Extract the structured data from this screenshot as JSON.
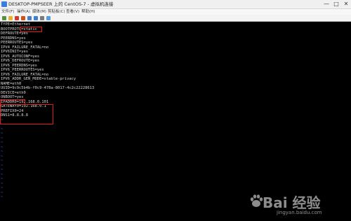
{
  "window": {
    "title": "DESKTOP-PMPSEER 上的 CentOS-7 - 虚拟机连接",
    "minimize": "—",
    "maximize": "□",
    "close": "✕"
  },
  "menu": [
    {
      "label": "文件(F)"
    },
    {
      "label": "操作(A)"
    },
    {
      "label": "媒体(M)"
    },
    {
      "label": "剪贴板(C)"
    },
    {
      "label": "查看(V)"
    },
    {
      "label": "帮助(H)"
    }
  ],
  "toolbar": {
    "colors": [
      "#5a8f3c",
      "#e6b32e",
      "#d23a2a",
      "#d24f20",
      "#4a7acb",
      "#3e7fd6",
      "#7a7a7a",
      "#5b9bd5"
    ]
  },
  "terminal": {
    "lines": [
      "TYPE=Ethernet",
      "BOOTPROTO=static",
      "DEFROUTE=yes",
      "PEERDNS=yes",
      "PEERROUTES=yes",
      "IPV4_FAILURE_FATAL=no",
      "IPV6INIT=yes",
      "IPV6_AUTOCONF=yes",
      "IPV6_DEFROUTE=yes",
      "IPV6_PEERDNS=yes",
      "IPV6_PEERROUTES=yes",
      "IPV6_FAILURE_FATAL=no",
      "IPV6_ADDR_GEN_MODE=stable-privacy",
      "NAME=eth0",
      "UUID=9c9c5b4b-f0c9-478a-8017-4c2c22228613",
      "DEVICE=eth0",
      "ONBOOT=yes",
      "IPADDR0=192.168.0.101",
      "GATEWAY0=192.168.0.1",
      "PREFIX0=24",
      "DNS1=8.8.8.8"
    ],
    "tilde": "~",
    "tilde_count": 18
  },
  "watermark": {
    "brand": "Bai  经验",
    "url": "jingyan.baidu.com"
  }
}
